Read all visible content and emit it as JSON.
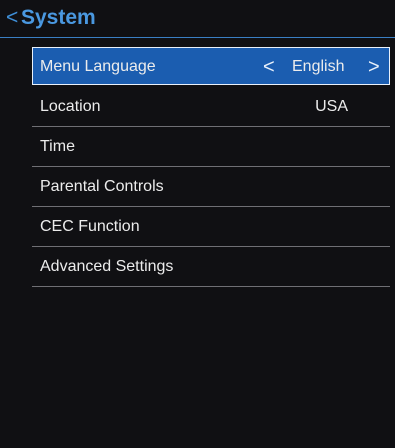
{
  "header": {
    "back_glyph": "<",
    "title": "System"
  },
  "menu": {
    "items": [
      {
        "label": "Menu Language",
        "value": "English",
        "selected": true
      },
      {
        "label": "Location",
        "value": "USA"
      },
      {
        "label": "Time",
        "value": ""
      },
      {
        "label": "Parental Controls",
        "value": ""
      },
      {
        "label": "CEC Function",
        "value": ""
      },
      {
        "label": "Advanced Settings",
        "value": ""
      }
    ],
    "prev_glyph": "<",
    "next_glyph": ">"
  },
  "colors": {
    "background": "#101013",
    "accent": "#4a98e0",
    "selected_bg": "#1b5db0",
    "divider": "#6f6f74",
    "text": "#ececec"
  }
}
